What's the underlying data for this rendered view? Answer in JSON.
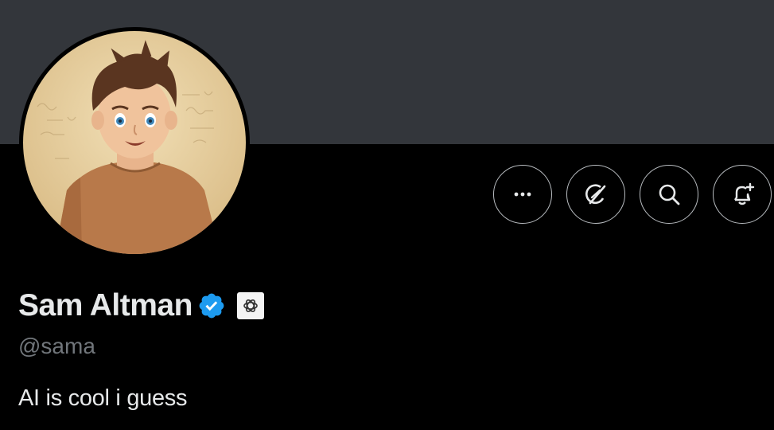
{
  "profile": {
    "display_name": "Sam Altman",
    "handle": "@sama",
    "bio": "AI is cool i guess",
    "verified_badge": "verified-checkmark-icon",
    "affiliate_badge": "openai-logo-icon"
  },
  "actions": [
    {
      "name": "more-options",
      "icon": "ellipsis-icon"
    },
    {
      "name": "grok",
      "icon": "grok-icon"
    },
    {
      "name": "search",
      "icon": "search-icon"
    },
    {
      "name": "subscribe-notifications",
      "icon": "bell-plus-icon"
    }
  ],
  "colors": {
    "banner": "#33363b",
    "background": "#000000",
    "text_primary": "#e7e9ea",
    "text_secondary": "#71767b",
    "verified_blue": "#1d9bf0",
    "button_border": "#b8bcc0"
  }
}
